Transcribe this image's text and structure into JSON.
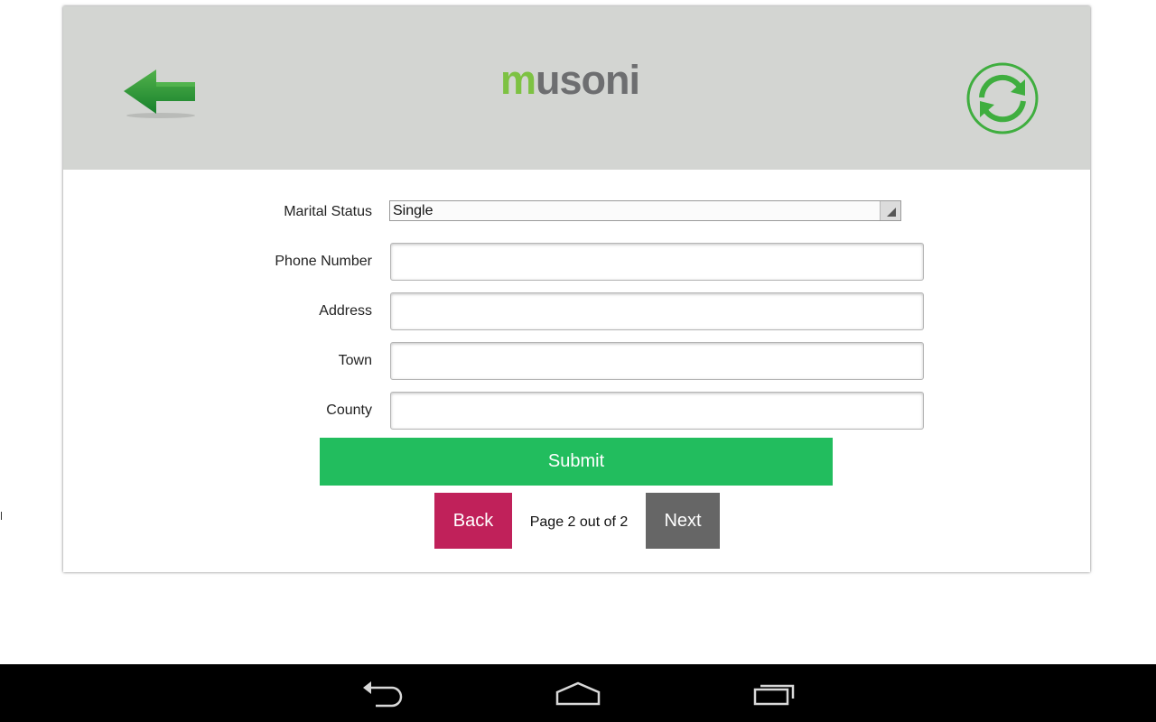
{
  "app": {
    "logo_first": "m",
    "logo_rest": "usoni"
  },
  "header": {
    "back_icon": "green-left-arrow-icon",
    "refresh_icon": "sync-refresh-icon"
  },
  "form": {
    "marital_status": {
      "label": "Marital Status",
      "selected": "Single"
    },
    "phone": {
      "label": "Phone Number",
      "value": ""
    },
    "address": {
      "label": "Address",
      "value": ""
    },
    "town": {
      "label": "Town",
      "value": ""
    },
    "county": {
      "label": "County",
      "value": ""
    },
    "submit_label": "Submit"
  },
  "pagination": {
    "back_label": "Back",
    "indicator": "Page 2 out of 2",
    "next_label": "Next"
  },
  "colors": {
    "header_bg": "#d3d5d2",
    "brand_green": "#7dc243",
    "brand_gray": "#6d6e70",
    "submit_green": "#22bd5e",
    "back_magenta": "#c0215a",
    "next_gray": "#666666"
  },
  "system_nav": {
    "back_icon": "android-back-icon",
    "home_icon": "android-home-icon",
    "recents_icon": "android-recents-icon"
  }
}
